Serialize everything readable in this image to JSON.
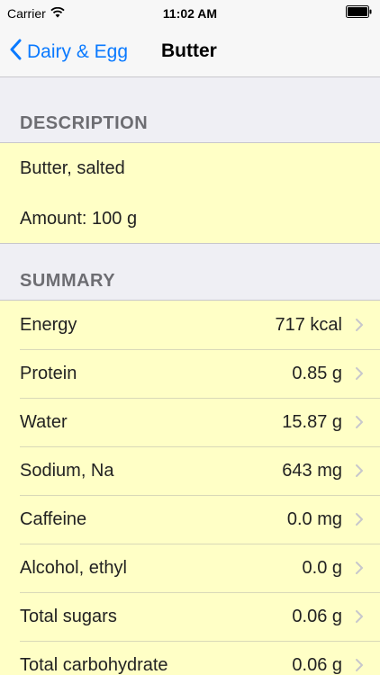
{
  "status_bar": {
    "carrier": "Carrier",
    "time": "11:02 AM",
    "icons": [
      "wifi-icon",
      "battery-icon"
    ]
  },
  "nav": {
    "back_label": "Dairy & Egg",
    "title": "Butter",
    "accent_color": "#0a7aff"
  },
  "description": {
    "header": "DESCRIPTION",
    "name": "Butter, salted",
    "amount": "Amount: 100 g"
  },
  "summary": {
    "header": "SUMMARY",
    "rows": [
      {
        "label": "Energy",
        "value": "717 kcal"
      },
      {
        "label": "Protein",
        "value": "0.85 g"
      },
      {
        "label": "Water",
        "value": "15.87 g"
      },
      {
        "label": "Sodium, Na",
        "value": "643 mg"
      },
      {
        "label": "Caffeine",
        "value": "0.0 mg"
      },
      {
        "label": "Alcohol, ethyl",
        "value": "0.0 g"
      },
      {
        "label": "Total sugars",
        "value": "0.06 g"
      },
      {
        "label": "Total carbohydrate",
        "value": "0.06 g"
      }
    ]
  },
  "colors": {
    "card_background": "#ffffc6",
    "page_background": "#efeff4"
  }
}
